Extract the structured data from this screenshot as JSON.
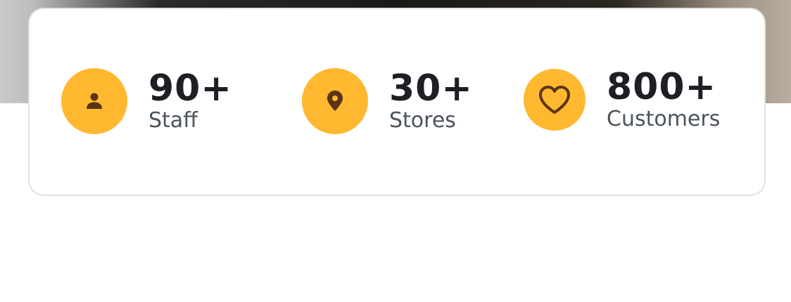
{
  "stats": [
    {
      "value": "90+",
      "label": "Staff",
      "icon": "person-icon"
    },
    {
      "value": "30+",
      "label": "Stores",
      "icon": "location-pin-icon"
    },
    {
      "value": "800+",
      "label": "Customers",
      "icon": "heart-icon"
    }
  ],
  "colors": {
    "accent": "#ffb830",
    "icon_glyph": "#5a3415",
    "value_text": "#1d1f24",
    "label_text": "#4b535b",
    "card_border": "#e2e2e2"
  }
}
